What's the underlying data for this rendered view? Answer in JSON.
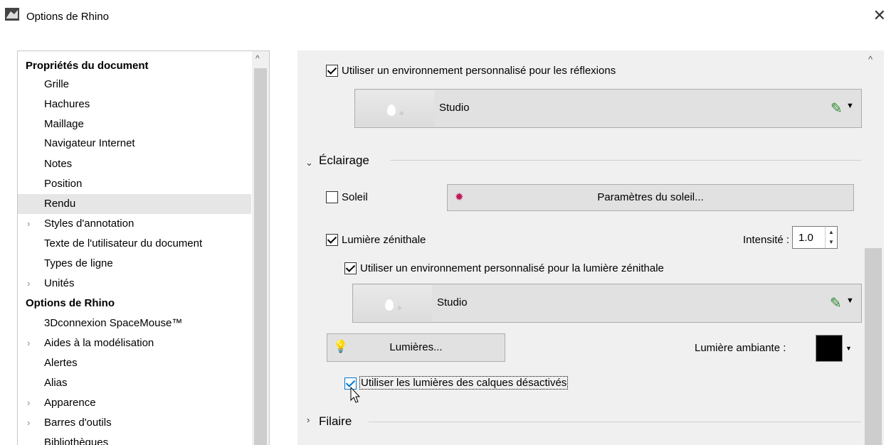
{
  "window": {
    "title": "Options de Rhino"
  },
  "tree": {
    "items": [
      {
        "label": "Propriétés du document",
        "kind": "section"
      },
      {
        "label": "Grille",
        "kind": "child"
      },
      {
        "label": "Hachures",
        "kind": "child"
      },
      {
        "label": "Maillage",
        "kind": "child"
      },
      {
        "label": "Navigateur Internet",
        "kind": "child"
      },
      {
        "label": "Notes",
        "kind": "child"
      },
      {
        "label": "Position",
        "kind": "child"
      },
      {
        "label": "Rendu",
        "kind": "child",
        "selected": true
      },
      {
        "label": "Styles d'annotation",
        "kind": "child",
        "expandable": true
      },
      {
        "label": "Texte de l'utilisateur du document",
        "kind": "child"
      },
      {
        "label": "Types de ligne",
        "kind": "child"
      },
      {
        "label": "Unités",
        "kind": "child",
        "expandable": true
      },
      {
        "label": "Options de Rhino",
        "kind": "section"
      },
      {
        "label": "3Dconnexion SpaceMouse™",
        "kind": "child"
      },
      {
        "label": "Aides à la modélisation",
        "kind": "child",
        "expandable": true
      },
      {
        "label": "Alertes",
        "kind": "child"
      },
      {
        "label": "Alias",
        "kind": "child"
      },
      {
        "label": "Apparence",
        "kind": "child",
        "expandable": true
      },
      {
        "label": "Barres d'outils",
        "kind": "child",
        "expandable": true
      },
      {
        "label": "Bibliothèques",
        "kind": "child"
      }
    ]
  },
  "panel": {
    "reflections_checkbox": "Utiliser un environnement personnalisé pour les réflexions",
    "reflections_env": "Studio",
    "lighting_section": "Éclairage",
    "sun_checkbox": "Soleil",
    "sun_button": "Paramètres du soleil...",
    "skylight_checkbox": "Lumière zénithale",
    "intensity_label": "Intensité :",
    "intensity_value": "1.0",
    "skylight_env_checkbox": "Utiliser un environnement personnalisé pour la lumière zénithale",
    "skylight_env": "Studio",
    "lights_button": "Lumières...",
    "ambient_label": "Lumière ambiante :",
    "ambient_color": "#000000",
    "hidden_layers_checkbox": "Utiliser les lumières des calques désactivés",
    "wireframe_section": "Filaire"
  }
}
